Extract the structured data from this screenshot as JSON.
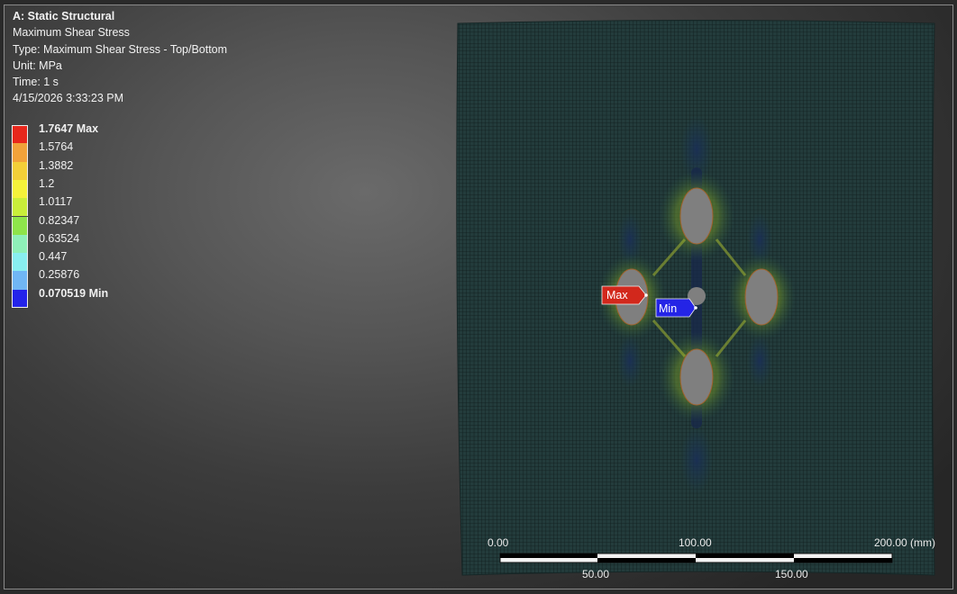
{
  "info": {
    "title": "A: Static Structural",
    "result": "Maximum Shear Stress",
    "type": "Type: Maximum Shear Stress - Top/Bottom",
    "unit": "Unit: MPa",
    "time": "Time: 1 s",
    "timestamp": "4/15/2026 3:33:23 PM"
  },
  "legend": [
    {
      "value": "1.7647 Max",
      "color": "#e8271c",
      "bold": true
    },
    {
      "value": "1.5764",
      "color": "#f1a23a"
    },
    {
      "value": "1.3882",
      "color": "#f3cf38"
    },
    {
      "value": "1.2",
      "color": "#f5f23a"
    },
    {
      "value": "1.0117",
      "color": "#c9ee3a"
    },
    {
      "value": "0.82347",
      "color": "#8ee44a"
    },
    {
      "value": "0.63524",
      "color": "#8ef0b8"
    },
    {
      "value": "0.447",
      "color": "#88eef0"
    },
    {
      "value": "0.25876",
      "color": "#70b6f5"
    },
    {
      "value": "0.070519 Min",
      "color": "#2323ea",
      "bold": true
    }
  ],
  "probes": {
    "max": {
      "label": "Max",
      "color": "#d2281c"
    },
    "min": {
      "label": "Min",
      "color": "#2424e6"
    }
  },
  "scale": {
    "labels_top": [
      "0.00",
      "100.00",
      "200.00 (mm)"
    ],
    "labels_bottom": [
      "50.00",
      "150.00"
    ]
  },
  "colors": {
    "mesh_fill": "#233c3c",
    "mesh_line": "#0f1a1a",
    "hole": "#7f7f7f"
  }
}
